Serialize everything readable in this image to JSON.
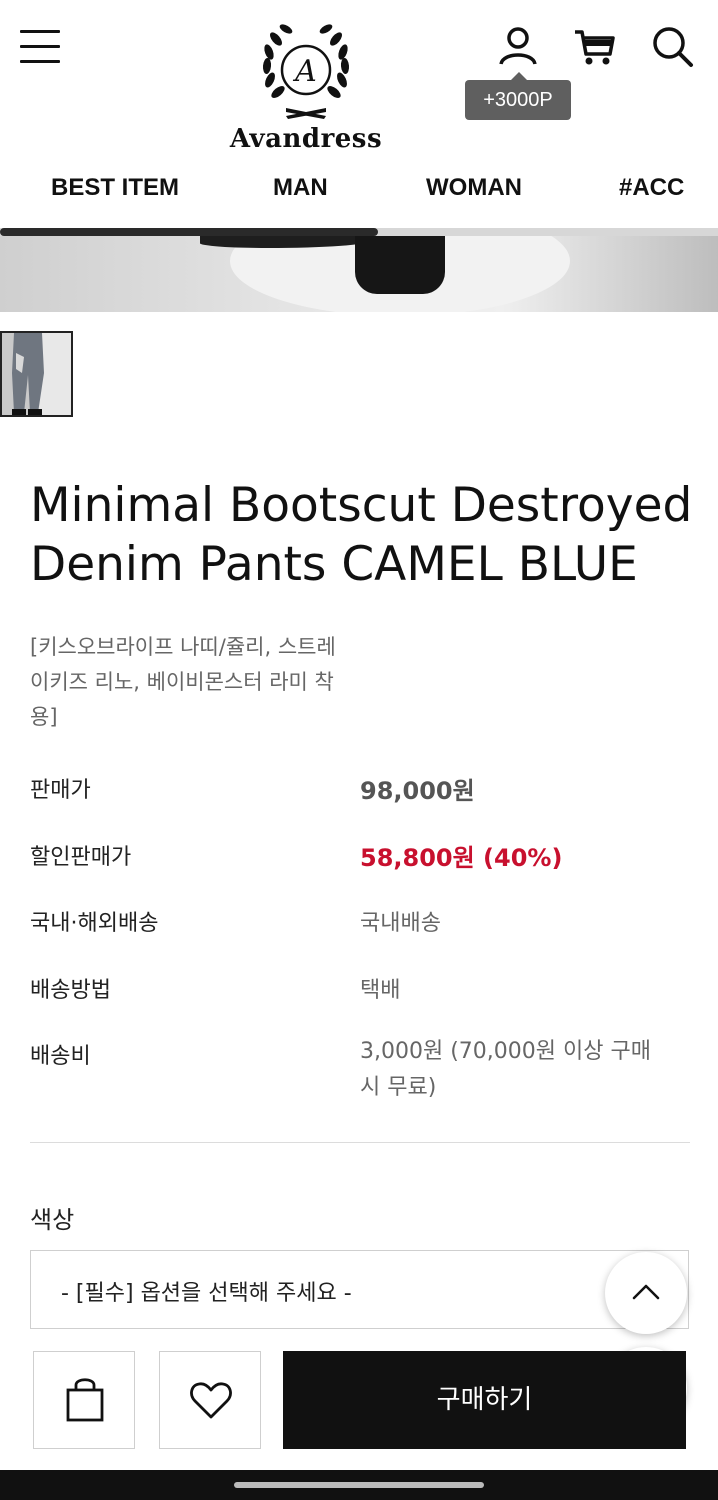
{
  "header": {
    "brand": "Avandress",
    "emblem_letter": "A",
    "points_badge": "+3000P",
    "icons": [
      "menu-icon",
      "user-icon",
      "cart-icon",
      "search-icon"
    ]
  },
  "nav": {
    "items": [
      "BEST ITEM",
      "MAN",
      "WOMAN",
      "#ACC"
    ]
  },
  "product": {
    "title": "Minimal Bootscut Destroyed Denim Pants CAMEL BLUE",
    "subtitle": "[키스오브라이프 나띠/쥴리, 스트레이키즈 리노, 베이비몬스터 라미 착용]",
    "info": {
      "price_label": "판매가",
      "price_value": "98,000원",
      "sale_label": "할인판매가",
      "sale_value": "58,800원 (40%)",
      "shipping_region_label": "국내·해외배송",
      "shipping_region_value": "국내배송",
      "shipping_method_label": "배송방법",
      "shipping_method_value": "택배",
      "shipping_fee_label": "배송비",
      "shipping_fee_value": "3,000원 (70,000원 이상 구매시 무료)"
    }
  },
  "options": {
    "color_label": "색상",
    "select_placeholder": "- [필수] 옵션을 선택해 주세요 -"
  },
  "actions": {
    "buy_label": "구매하기"
  },
  "colors": {
    "sale": "#c8102e",
    "badge_bg": "#5f5f5f",
    "buy_bg": "#111111"
  }
}
